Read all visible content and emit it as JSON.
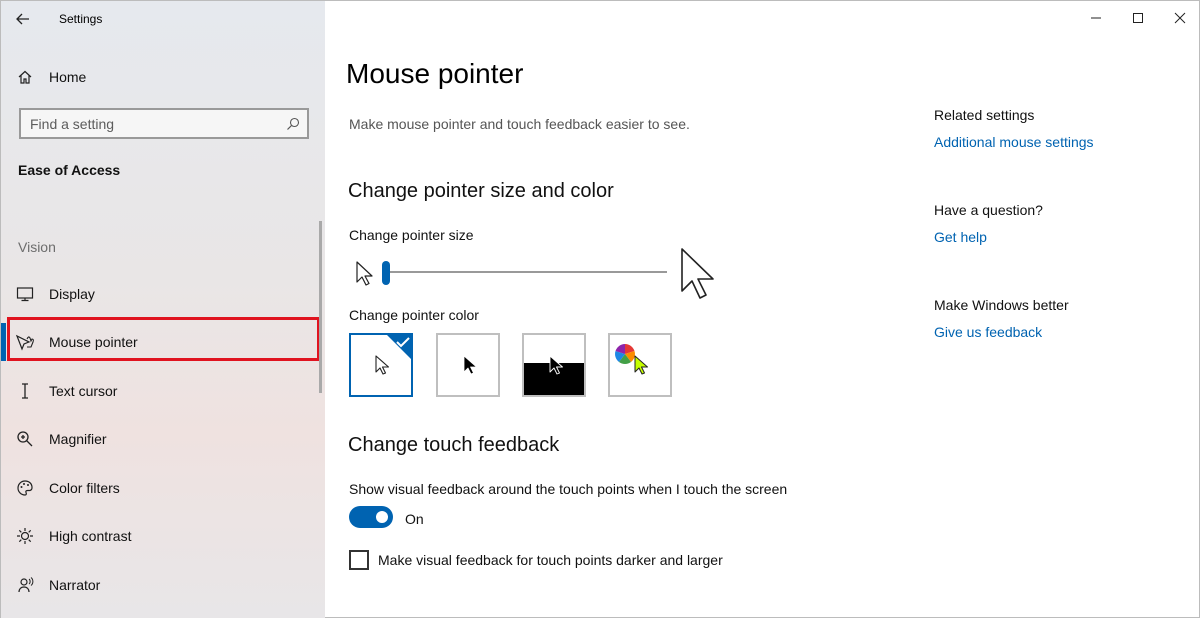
{
  "app": {
    "title": "Settings"
  },
  "sidebar": {
    "home_label": "Home",
    "search_placeholder": "Find a setting",
    "section_title": "Ease of Access",
    "group_label": "Vision",
    "items": [
      {
        "label": "Display",
        "icon": "monitor-icon"
      },
      {
        "label": "Mouse pointer",
        "icon": "mouse-pointer-icon",
        "selected": true
      },
      {
        "label": "Text cursor",
        "icon": "text-cursor-icon"
      },
      {
        "label": "Magnifier",
        "icon": "magnifier-icon"
      },
      {
        "label": "Color filters",
        "icon": "palette-icon"
      },
      {
        "label": "High contrast",
        "icon": "sun-icon"
      },
      {
        "label": "Narrator",
        "icon": "narrator-icon"
      }
    ]
  },
  "main": {
    "title": "Mouse pointer",
    "description": "Make mouse pointer and touch feedback easier to see.",
    "size_color_heading": "Change pointer size and color",
    "size_label": "Change pointer size",
    "pointer_size_value": 1,
    "color_label": "Change pointer color",
    "color_options": [
      {
        "name": "white",
        "selected": true
      },
      {
        "name": "black",
        "selected": false
      },
      {
        "name": "inverted",
        "selected": false
      },
      {
        "name": "custom",
        "selected": false
      }
    ],
    "touch_heading": "Change touch feedback",
    "touch_label": "Show visual feedback around the touch points when I touch the screen",
    "toggle_state": "On",
    "checkbox_label": "Make visual feedback for touch points darker and larger",
    "checkbox_checked": false
  },
  "related": {
    "related_heading": "Related settings",
    "related_link": "Additional mouse settings",
    "question_heading": "Have a question?",
    "question_link": "Get help",
    "better_heading": "Make Windows better",
    "better_link": "Give us feedback"
  },
  "colors": {
    "accent": "#0063b1",
    "highlight": "#e0131f"
  }
}
